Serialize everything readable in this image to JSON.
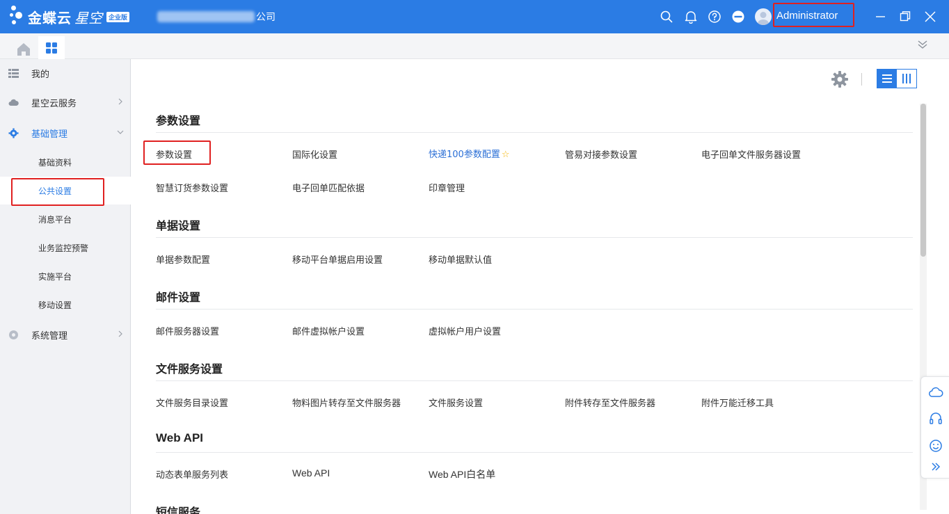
{
  "app": {
    "logo_name": "金蝶云",
    "logo_sub": "星空",
    "edition_badge": "企业版",
    "company_suffix": "公司",
    "username": "Administrator",
    "brand_color": "#2b7ce4",
    "header_icons": [
      "search-icon",
      "bell-icon",
      "help-icon",
      "more-icon"
    ]
  },
  "sidebar": {
    "items": [
      {
        "label": "我的",
        "icon": "list-icon"
      },
      {
        "label": "星空云服务",
        "icon": "cloud-icon"
      },
      {
        "label": "基础管理",
        "icon": "gear-icon"
      },
      {
        "label": "系统管理",
        "icon": "settings-icon"
      }
    ],
    "subitems": [
      {
        "label": "基础资料"
      },
      {
        "label": "公共设置"
      },
      {
        "label": "消息平台"
      },
      {
        "label": "业务监控预警"
      },
      {
        "label": "实施平台"
      },
      {
        "label": "移动设置"
      }
    ]
  },
  "sections": [
    {
      "title": "参数设置",
      "links": [
        "参数设置",
        "国际化设置",
        "快递100参数配置",
        "管易对接参数设置",
        "电子回单文件服务器设置",
        "智慧订货参数设置",
        "电子回单匹配依据",
        "印章管理"
      ]
    },
    {
      "title": "单据设置",
      "links": [
        "单据参数配置",
        "移动平台单据启用设置",
        "移动单据默认值"
      ]
    },
    {
      "title": "邮件设置",
      "links": [
        "邮件服务器设置",
        "邮件虚拟帐户设置",
        "虚拟帐户用户设置"
      ]
    },
    {
      "title": "文件服务设置",
      "links": [
        "文件服务目录设置",
        "物料图片转存至文件服务器",
        "文件服务设置",
        "附件转存至文件服务器",
        "附件万能迁移工具"
      ]
    },
    {
      "title": "Web API",
      "links": [
        "动态表单服务列表",
        "Web API",
        "Web API白名单"
      ]
    },
    {
      "title": "短信服务",
      "links": []
    }
  ]
}
